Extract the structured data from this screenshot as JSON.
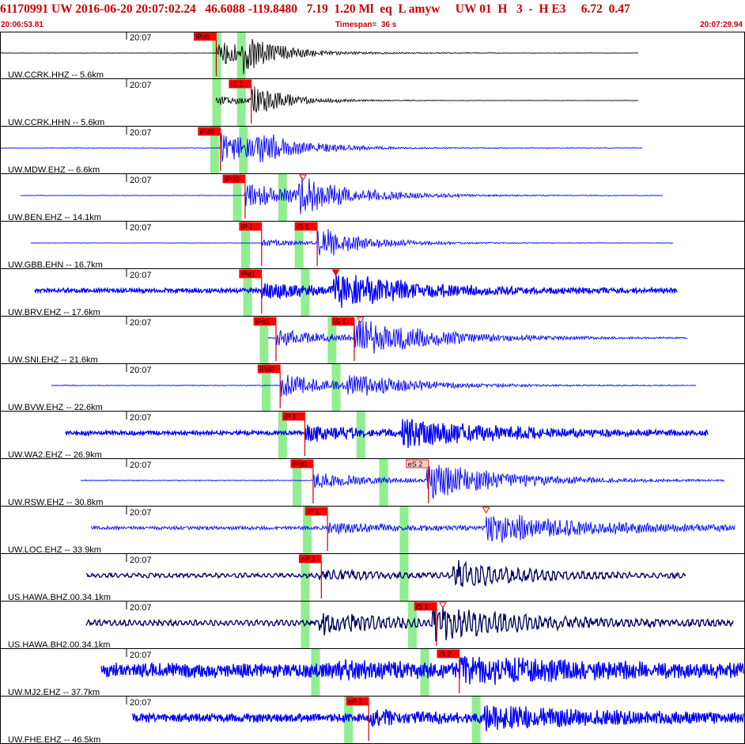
{
  "header": {
    "event_line": "61170991 UW 2016-06-20 20:07:02.24   46.6088 -119.8480   7.19  1.20 Ml  eq  L amyw     UW 01  H   3  -  H E3     6.72  0.47",
    "start_time": "20:06:53.81",
    "timespan": "Timespan=  36 s",
    "end_time": "20:07:29.94"
  },
  "chart_data": {
    "type": "line",
    "x_start": "20:06:53.81",
    "x_end": "20:07:29.94",
    "timespan_s": 36,
    "xlim": [
      0,
      36.13
    ],
    "grid": false,
    "colors": {
      "header_text": "#cc0000",
      "pick_box": "#ff0000",
      "pick_box_emergent": "#ffcccc",
      "pick_line": "#cc0000",
      "theoretical_band": "#90ee90",
      "trace_black": "#000000",
      "trace_blue": "#0000ff",
      "trace_navy": "#000060"
    },
    "traces": [
      {
        "label": "UW.CCRK.HHZ -- 5.6km",
        "time_tick": "20:07",
        "color": "black",
        "data_start": 0.0,
        "data_end": 31.0,
        "p_arrival": 10.5,
        "s_arrival": 11.8,
        "noise_amp": 0.3,
        "p_amp": 16,
        "s_amp": 28,
        "coda_decay": 0.55,
        "freq": 2.8,
        "seed": 1,
        "picks": [
          {
            "label": "iPd0",
            "t": 10.5,
            "style": "impulsive"
          }
        ],
        "theo_bands": [
          10.5,
          11.7
        ]
      },
      {
        "label": "UW.CCRK.HHN -- 5.6km",
        "time_tick": "20:07",
        "color": "black",
        "data_start": 10.5,
        "data_end": 31.0,
        "p_arrival": 10.5,
        "s_arrival": 12.2,
        "noise_amp": 0.3,
        "p_amp": 6,
        "s_amp": 22,
        "coda_decay": 0.55,
        "freq": 2.8,
        "seed": 2,
        "picks": [
          {
            "label": "iS 1",
            "t": 12.2,
            "style": "impulsive"
          }
        ],
        "theo_bands": [
          10.5,
          11.7
        ]
      },
      {
        "label": "UW.MDW.EHZ -- 6.6km",
        "time_tick": "20:07",
        "color": "blue",
        "data_start": 0.0,
        "data_end": 31.2,
        "p_arrival": 10.7,
        "s_arrival": 12.4,
        "noise_amp": 0.4,
        "p_amp": 20,
        "s_amp": 26,
        "coda_decay": 0.45,
        "freq": 3.0,
        "seed": 3,
        "picks": [
          {
            "label": "iPd0",
            "t": 10.7,
            "style": "impulsive"
          }
        ],
        "theo_bands": [
          10.4,
          11.8
        ]
      },
      {
        "label": "UW.BEN.EHZ -- 14.1km",
        "time_tick": "20:07",
        "color": "blue",
        "data_start": 1.0,
        "data_end": 32.2,
        "p_arrival": 11.9,
        "s_arrival": 14.5,
        "noise_amp": 0.4,
        "p_amp": 18,
        "s_amp": 26,
        "coda_decay": 0.35,
        "freq": 3.0,
        "seed": 4,
        "picks": [
          {
            "label": "iPd0",
            "t": 11.9,
            "style": "impulsive"
          },
          {
            "label": "",
            "t": 14.7,
            "style": "triangle"
          }
        ],
        "theo_bands": [
          11.5,
          13.7
        ]
      },
      {
        "label": "UW.GBB.EHN -- 16.7km",
        "time_tick": "20:07",
        "color": "blue",
        "data_start": 1.5,
        "data_end": 32.7,
        "p_arrival": 12.7,
        "s_arrival": 15.4,
        "noise_amp": 0.3,
        "p_amp": 5,
        "s_amp": 22,
        "coda_decay": 0.4,
        "freq": 3.0,
        "seed": 5,
        "picks": [
          {
            "label": "iP 1",
            "t": 12.7,
            "style": "impulsive"
          },
          {
            "label": "iS 1",
            "t": 15.4,
            "style": "impulsive"
          }
        ],
        "theo_bands": [
          11.9,
          14.5
        ]
      },
      {
        "label": "UW.BRV.EHZ -- 17.6km",
        "time_tick": "20:07",
        "color": "blue",
        "data_start": 1.7,
        "data_end": 32.9,
        "p_arrival": 12.7,
        "s_arrival": 16.2,
        "noise_amp": 3.0,
        "p_amp": 10,
        "s_amp": 24,
        "coda_decay": 0.25,
        "freq": 3.2,
        "seed": 6,
        "picks": [
          {
            "label": "iPd1",
            "t": 12.7,
            "style": "impulsive"
          },
          {
            "label": "",
            "t": 16.3,
            "style": "triangle-filled"
          }
        ],
        "theo_bands": [
          12.0,
          14.8
        ]
      },
      {
        "label": "UW.SNI.EHZ -- 21.6km",
        "time_tick": "20:07",
        "color": "blue",
        "data_start": 13.0,
        "data_end": 33.4,
        "p_arrival": 13.4,
        "s_arrival": 17.2,
        "noise_amp": 0.6,
        "p_amp": 12,
        "s_amp": 26,
        "coda_decay": 0.25,
        "freq": 3.0,
        "seed": 7,
        "picks": [
          {
            "label": "iPd1",
            "t": 13.4,
            "style": "impulsive"
          },
          {
            "label": "iS 1",
            "t": 17.2,
            "style": "impulsive"
          },
          {
            "label": "",
            "t": 17.5,
            "style": "triangle"
          }
        ],
        "theo_bands": [
          12.8,
          16.1
        ]
      },
      {
        "label": "UW.BVW.EHZ -- 22.6km",
        "time_tick": "20:07",
        "color": "blue",
        "data_start": 2.5,
        "data_end": 33.8,
        "p_arrival": 13.6,
        "s_arrival": 16.8,
        "noise_amp": 0.5,
        "p_amp": 16,
        "s_amp": 18,
        "coda_decay": 0.3,
        "freq": 3.0,
        "seed": 8,
        "picks": [
          {
            "label": "iPd0",
            "t": 13.6,
            "style": "impulsive"
          }
        ],
        "theo_bands": [
          12.9,
          16.3
        ]
      },
      {
        "label": "UW.WA2.EHZ -- 26.9km",
        "time_tick": "20:07",
        "color": "blue",
        "data_start": 3.2,
        "data_end": 34.4,
        "p_arrival": 14.8,
        "s_arrival": 19.5,
        "noise_amp": 3.0,
        "p_amp": 10,
        "s_amp": 18,
        "coda_decay": 0.2,
        "freq": 3.2,
        "seed": 9,
        "picks": [
          {
            "label": "iP 1",
            "t": 14.8,
            "style": "impulsive"
          }
        ],
        "theo_bands": [
          13.7,
          17.5
        ]
      },
      {
        "label": "UW.RSW.EHZ -- 30.8km",
        "time_tick": "20:07",
        "color": "blue",
        "data_start": 3.9,
        "data_end": 35.2,
        "p_arrival": 15.2,
        "s_arrival": 20.7,
        "noise_amp": 0.6,
        "p_amp": 12,
        "s_amp": 26,
        "coda_decay": 0.25,
        "freq": 3.0,
        "seed": 10,
        "picks": [
          {
            "label": "iPd0",
            "t": 15.2,
            "style": "impulsive"
          },
          {
            "label": "eS 2",
            "t": 20.8,
            "style": "emergent"
          }
        ],
        "theo_bands": [
          14.4,
          18.6
        ]
      },
      {
        "label": "UW.LOC.EHZ -- 33.9km",
        "time_tick": "20:07",
        "color": "blue",
        "data_start": 4.4,
        "data_end": 35.7,
        "p_arrival": 15.9,
        "s_arrival": 23.6,
        "noise_amp": 2.5,
        "p_amp": 8,
        "s_amp": 20,
        "coda_decay": 0.2,
        "freq": 3.0,
        "seed": 11,
        "picks": [
          {
            "label": "iP 1",
            "t": 15.9,
            "style": "impulsive"
          },
          {
            "label": "",
            "t": 23.6,
            "style": "triangle"
          }
        ],
        "theo_bands": [
          14.9,
          19.6
        ]
      },
      {
        "label": "US.HAWA.BHZ.00.34.1km",
        "time_tick": "20:07",
        "color": "navy",
        "data_start": 4.2,
        "data_end": 33.3,
        "p_arrival": 15.5,
        "s_arrival": 22.0,
        "noise_amp": 3.0,
        "p_amp": 6,
        "s_amp": 18,
        "coda_decay": 0.3,
        "freq": 1.2,
        "seed": 12,
        "picks": [
          {
            "label": "eP 2",
            "t": 15.6,
            "style": "impulsive"
          }
        ],
        "theo_bands": [
          14.8,
          19.6
        ]
      },
      {
        "label": "US.HAWA.BH2.00.34.1km",
        "time_tick": "20:07",
        "color": "navy",
        "data_start": 4.2,
        "data_end": 35.6,
        "p_arrival": 15.5,
        "s_arrival": 21.0,
        "noise_amp": 4.0,
        "p_amp": 14,
        "s_amp": 22,
        "coda_decay": 0.25,
        "freq": 1.4,
        "seed": 13,
        "picks": [
          {
            "label": "iS 1",
            "t": 21.2,
            "style": "impulsive"
          },
          {
            "label": "",
            "t": 21.5,
            "style": "triangle"
          }
        ],
        "theo_bands": [
          14.8,
          20.0
        ]
      },
      {
        "label": "UW.MJ2.EHZ -- 37.7km",
        "time_tick": "20:07",
        "color": "blue",
        "data_start": 4.9,
        "data_end": 36.1,
        "p_arrival": 16.4,
        "s_arrival": 22.3,
        "noise_amp": 10.0,
        "p_amp": 6,
        "s_amp": 12,
        "coda_decay": 0.2,
        "freq": 3.4,
        "seed": 14,
        "picks": [
          {
            "label": "iS 2",
            "t": 22.3,
            "style": "impulsive"
          }
        ],
        "theo_bands": [
          15.3,
          20.6
        ]
      },
      {
        "label": "UW.FHE.EHZ -- 46.5km",
        "time_tick": "20:07",
        "color": "blue",
        "data_start": 6.4,
        "data_end": 36.1,
        "p_arrival": 17.9,
        "s_arrival": 23.5,
        "noise_amp": 6.0,
        "p_amp": 8,
        "s_amp": 12,
        "coda_decay": 0.15,
        "freq": 3.3,
        "seed": 15,
        "picks": [
          {
            "label": "eP 2",
            "t": 17.9,
            "style": "impulsive"
          }
        ],
        "theo_bands": [
          16.9,
          23.1
        ]
      }
    ]
  }
}
